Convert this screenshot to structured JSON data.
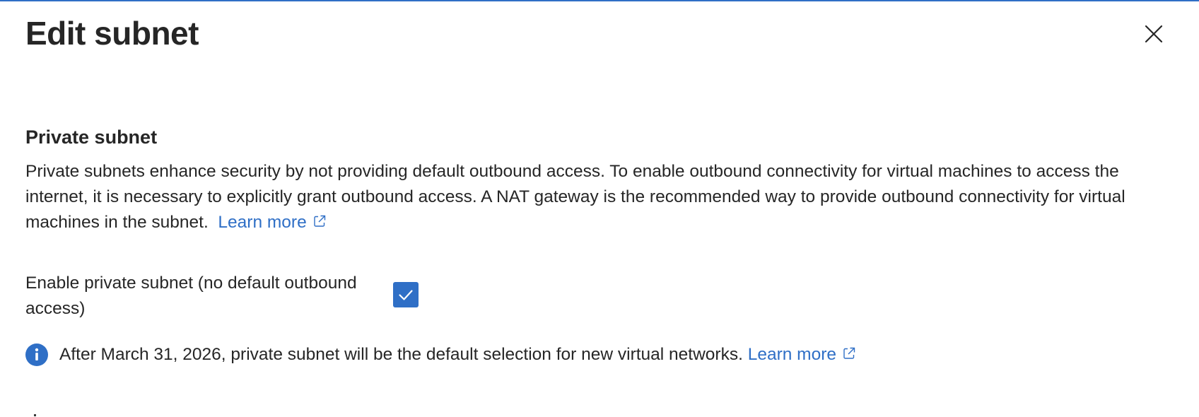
{
  "panel": {
    "title": "Edit subnet",
    "close_icon": "close-icon"
  },
  "private_subnet": {
    "heading": "Private subnet",
    "description": "Private subnets enhance security by not providing default outbound access. To enable outbound connectivity for virtual machines to access the internet, it is necessary to explicitly grant outbound access. A NAT gateway is the recommended way to provide outbound connectivity for virtual machines in the subnet.",
    "learn_more": "Learn more",
    "checkbox_label": "Enable private subnet (no default outbound access)",
    "checkbox_checked": true,
    "info_text": "After March 31, 2026, private subnet will be the default selection for new virtual networks.",
    "info_learn_more": "Learn more"
  },
  "colors": {
    "accent": "#2f6fc6",
    "text": "#262626"
  }
}
